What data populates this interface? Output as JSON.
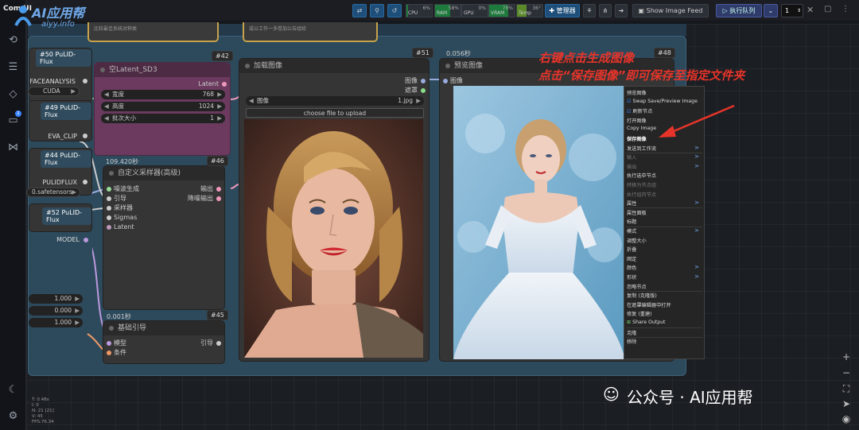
{
  "app": {
    "logo_left": "Com UI",
    "logo_watermark": "AI应用帮",
    "logo_url": "aiyy.info"
  },
  "toolbar": {
    "meters": [
      {
        "label": "CPU",
        "pct": "6%",
        "level": 6
      },
      {
        "label": "RAM",
        "pct": "58%",
        "level": 58
      },
      {
        "label": "GPU",
        "pct": "0%",
        "level": 0
      },
      {
        "label": "VRAM",
        "pct": "76%",
        "level": 76
      },
      {
        "label": "Temp",
        "pct": "36°",
        "level": 36
      }
    ],
    "manager_label": "管理器",
    "show_image_feed": "Show Image Feed",
    "run_queue": "执行队列",
    "queue_count": "1"
  },
  "nodes": {
    "pulid_50": {
      "id": "#50",
      "title": "PuLID-Flux",
      "slot_a": "FACEANALYSIS",
      "slot_b": "CUDA"
    },
    "latent": {
      "id": "#42",
      "title": "空Latent_SD3",
      "output": "Latent",
      "widgets": [
        {
          "name": "宽度",
          "value": "768"
        },
        {
          "name": "高度",
          "value": "1024"
        },
        {
          "name": "批次大小",
          "value": "1"
        }
      ],
      "time": "109.420秒"
    },
    "pulid_49": {
      "id": "#49",
      "title": "PuLID-Flux",
      "slot": "EVA_CLIP"
    },
    "pulid_44": {
      "id": "#44",
      "title": "PuLID-Flux",
      "slot": "PULIDFLUX",
      "file": "0.safetensors"
    },
    "pulid_52": {
      "id": "#52",
      "title": "PuLID-Flux"
    },
    "sampler": {
      "id": "#46",
      "title": "自定义采样器(高级)",
      "inputs": [
        "噪波生成",
        "引导",
        "采样器",
        "Sigmas",
        "Latent"
      ],
      "outputs": [
        "输出",
        "降噪输出"
      ]
    },
    "model_slot": "MODEL",
    "left_widgets": [
      "1.000",
      "0.000",
      "1.000"
    ],
    "guide": {
      "id": "#45",
      "title": "基础引导",
      "inputs": [
        "模型",
        "条件"
      ],
      "output": "引导",
      "time": "0.001秒"
    },
    "load_image": {
      "id": "#51",
      "title": "加载图像",
      "outputs": [
        "图像",
        "遮罩"
      ],
      "field_name": "图像",
      "file": "1.jpg",
      "upload": "choose file to upload"
    },
    "preview": {
      "id": "#48",
      "title": "预览图像",
      "input": "图像",
      "time": "0.056秒"
    },
    "top_notes": [
      "比较最佳系统对称类",
      "或以工作一多卷加公告组给"
    ]
  },
  "context_menu": {
    "items": [
      {
        "label": "预览图像",
        "style": "normal"
      },
      {
        "label": "Swap Save/Preview Image",
        "style": "check"
      },
      {
        "label": "刷新节点",
        "style": "check"
      },
      {
        "label": "打开图像",
        "style": "normal"
      },
      {
        "label": "Copy Image",
        "style": "normal"
      },
      {
        "label": "保存图像",
        "style": "bold"
      },
      {
        "label": "发送到工作流",
        "style": "arrow"
      },
      {
        "label": "输入",
        "style": "dim-arrow"
      },
      {
        "label": "输出",
        "style": "dim-arrow"
      },
      {
        "label": "执行选中节点",
        "style": "normal"
      },
      {
        "label": "转换为节点组",
        "style": "dim"
      },
      {
        "label": "执行组内节点",
        "style": "dim"
      },
      {
        "label": "属性",
        "style": "arrow"
      },
      {
        "label": "属性面板",
        "style": "normal"
      },
      {
        "label": "标题",
        "style": "normal"
      },
      {
        "label": "模式",
        "style": "arrow"
      },
      {
        "label": "调整大小",
        "style": "normal"
      },
      {
        "label": "折叠",
        "style": "normal"
      },
      {
        "label": "固定",
        "style": "normal"
      },
      {
        "label": "颜色",
        "style": "arrow"
      },
      {
        "label": "形状",
        "style": "arrow"
      },
      {
        "label": "忽略节点",
        "style": "normal"
      },
      {
        "label": "复制 (克隆版)",
        "style": "normal"
      },
      {
        "label": "在遮罩编辑器中打开",
        "style": "normal"
      },
      {
        "label": "修复 (重建)",
        "style": "normal"
      },
      {
        "label": "Share Output",
        "style": "icon"
      },
      {
        "label": "克隆",
        "style": "normal"
      },
      {
        "label": "移除",
        "style": "normal"
      }
    ]
  },
  "annotation": {
    "line1": "右键点击生成图像",
    "line2": "点击“保存图像”即可保存至指定文件夹"
  },
  "stats": [
    "T: 0.48s",
    "I: 0",
    "N: 21 [21]",
    "V: 45",
    "FPS:76.34"
  ],
  "watermark": "公众号 · AI应用帮",
  "colors": {
    "accent": "#3a86ff",
    "annotation": "#e7342a",
    "group": "#2d4a5c",
    "latent_node": "#6b3a5e"
  }
}
